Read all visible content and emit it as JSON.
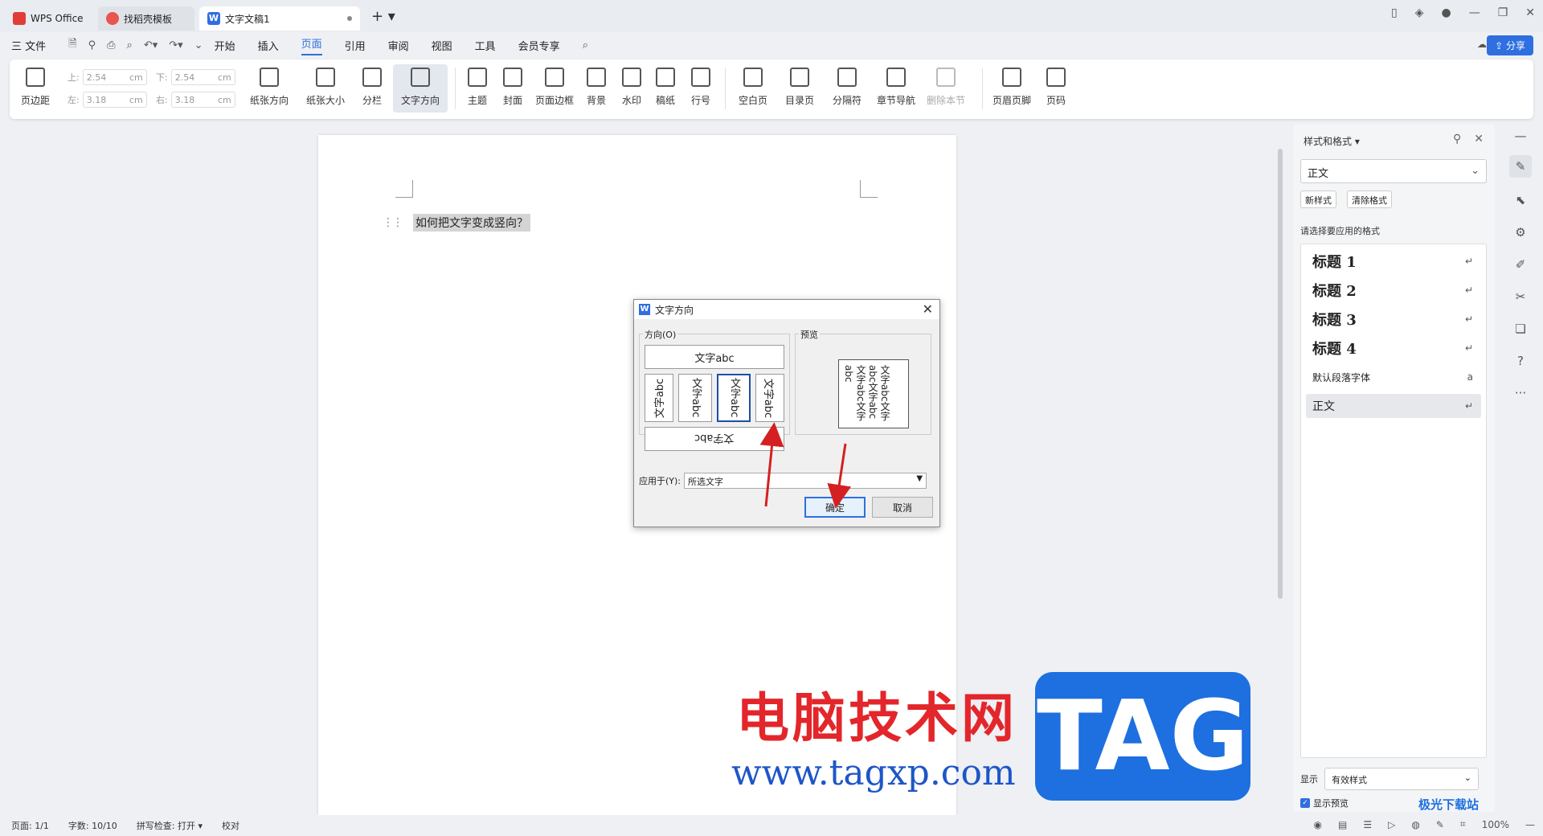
{
  "tabs": [
    {
      "label": "WPS Office"
    },
    {
      "label": "找稻壳模板"
    },
    {
      "label": "文字文稿1"
    }
  ],
  "menu": {
    "file": "三 文件",
    "items": [
      "开始",
      "插入",
      "页面",
      "引用",
      "审阅",
      "视图",
      "工具",
      "会员专享"
    ],
    "active": "页面",
    "share": "分享"
  },
  "ribbon": {
    "margins_label": "页边距",
    "top_label": "上:",
    "top_value": "2.54",
    "bottom_label": "下:",
    "bottom_value": "2.54",
    "left_label": "左:",
    "left_value": "3.18",
    "right_label": "右:",
    "right_value": "3.18",
    "unit": "cm",
    "buttons": [
      "纸张方向",
      "纸张大小",
      "分栏",
      "文字方向",
      "主题",
      "封面",
      "页面边框",
      "背景",
      "水印",
      "稿纸",
      "行号",
      "空白页",
      "目录页",
      "分隔符",
      "章节导航",
      "删除本节",
      "页眉页脚",
      "页码"
    ]
  },
  "document": {
    "text": "如何把文字变成竖向？"
  },
  "dialog": {
    "title": "文字方向",
    "direction_label": "方向(O)",
    "preview_label": "预览",
    "opt_horizontal": "文字abc",
    "opt_rot90": "文字abc",
    "opt_stack1": "文字abc",
    "opt_stack2": "文字abc",
    "opt_rotm90": "文字abc",
    "opt_flipped": "文字abc",
    "preview_text": "文字abc文字abc文字abc文字abc文字abc",
    "apply_label": "应用于(Y):",
    "apply_value": "所选文字",
    "ok": "确定",
    "cancel": "取消"
  },
  "panel": {
    "title": "样式和格式",
    "current_style": "正文",
    "new_style": "新样式",
    "clear_format": "清除格式",
    "choose_label": "请选择要应用的格式",
    "styles": [
      {
        "label": "标题  1"
      },
      {
        "label": "标题  2"
      },
      {
        "label": "标题  3"
      },
      {
        "label": "标题  4"
      },
      {
        "label": "默认段落字体"
      },
      {
        "label": "正文"
      }
    ],
    "show_label": "显示",
    "show_value": "有效样式",
    "show_preview": "显示预览"
  },
  "status": {
    "page": "页面: 1/1",
    "words": "字数: 10/10",
    "spell": "拼写检查: 打开",
    "proof": "校对",
    "zoom": "100%"
  },
  "watermark": {
    "cn": "电脑技术网",
    "url": "www.tagxp.com",
    "tag": "TAG",
    "corner": "极光下载站"
  },
  "colors": {
    "accent": "#2f6fe0",
    "arrow": "#d42020"
  }
}
